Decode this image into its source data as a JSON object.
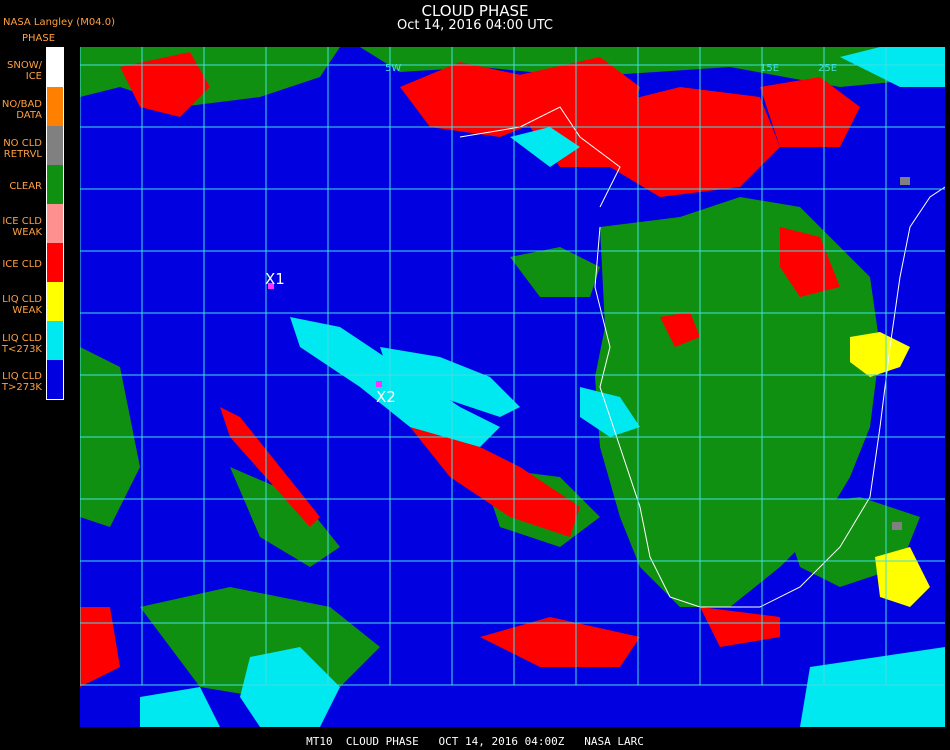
{
  "header": {
    "title": "CLOUD PHASE",
    "subtitle": "Oct 14, 2016 04:00 UTC",
    "source": "NASA Langley (M04.0)"
  },
  "legend": {
    "title": "PHASE",
    "items": [
      {
        "label": "SNOW/\nICE",
        "color": "#ffffff"
      },
      {
        "label": "NO/BAD\nDATA",
        "color": "#ff8000"
      },
      {
        "label": "NO CLD\nRETRVL",
        "color": "#808080"
      },
      {
        "label": "CLEAR",
        "color": "#109010"
      },
      {
        "label": "ICE CLD\nWEAK",
        "color": "#ff9090"
      },
      {
        "label": "ICE CLD",
        "color": "#ff0000"
      },
      {
        "label": "LIQ CLD\nWEAK",
        "color": "#ffff00"
      },
      {
        "label": "LIQ CLD\nT<273K",
        "color": "#00e8f0"
      },
      {
        "label": "LIQ CLD\nT>273K",
        "color": "#0000e0"
      }
    ]
  },
  "map": {
    "grid_labels": [
      "5W",
      "15E",
      "25E"
    ],
    "markers": [
      {
        "label": "X1"
      },
      {
        "label": "X2"
      }
    ],
    "colors": {
      "grid": "#40e0e0",
      "coast": "#ffffff",
      "marker": "#ff30ff"
    }
  },
  "footer": "MT10  CLOUD PHASE   OCT 14, 2016 04:00Z   NASA LARC"
}
